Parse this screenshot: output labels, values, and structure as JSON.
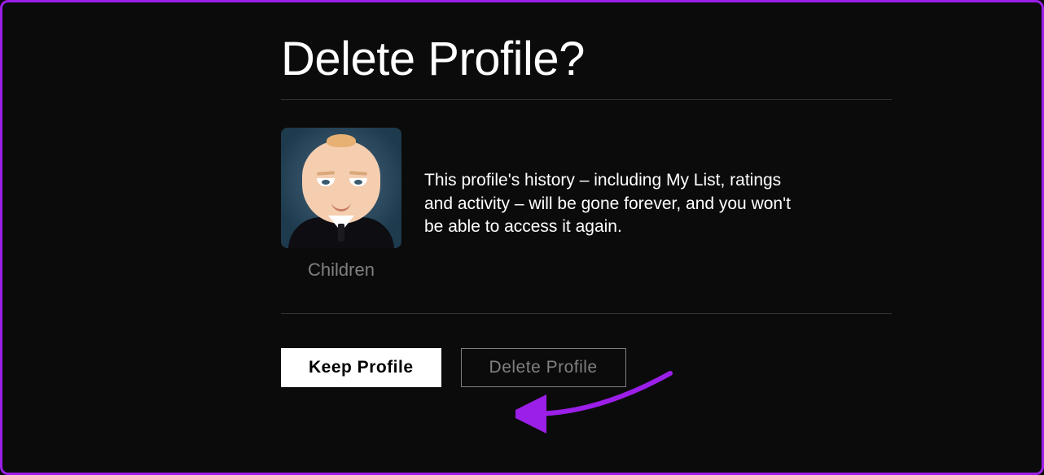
{
  "dialog": {
    "title": "Delete Profile?",
    "profile_name": "Children",
    "warning_text": "This profile's history – including My List, ratings and activity – will be gone forever, and you won't be able to access it again.",
    "keep_button": "Keep Profile",
    "delete_button": "Delete Profile"
  },
  "annotation": {
    "arrow_color": "#9b1fe8"
  }
}
